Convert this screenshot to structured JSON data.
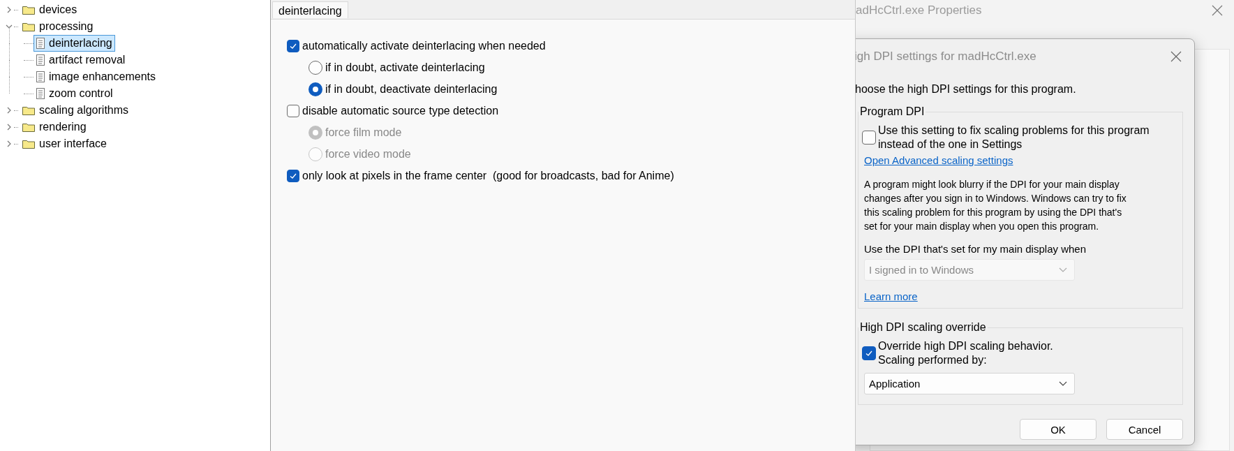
{
  "tree": [
    {
      "label": "devices",
      "kind": "folder",
      "expanded": false,
      "selected": false
    },
    {
      "label": "processing",
      "kind": "folder",
      "expanded": true,
      "selected": false,
      "children": [
        {
          "label": "deinterlacing",
          "kind": "page",
          "selected": true
        },
        {
          "label": "artifact removal",
          "kind": "page",
          "selected": false
        },
        {
          "label": "image enhancements",
          "kind": "page",
          "selected": false
        },
        {
          "label": "zoom control",
          "kind": "page",
          "selected": false
        }
      ]
    },
    {
      "label": "scaling algorithms",
      "kind": "folder",
      "expanded": false,
      "selected": false
    },
    {
      "label": "rendering",
      "kind": "folder",
      "expanded": false,
      "selected": false
    },
    {
      "label": "user interface",
      "kind": "folder",
      "expanded": false,
      "selected": false
    }
  ],
  "panel": {
    "tab": "deinterlacing",
    "options": [
      {
        "label": "automatically activate deinterlacing when needed",
        "checked": true,
        "children": [
          {
            "label": "if in doubt, activate deinterlacing",
            "selected": false,
            "disabled": false
          },
          {
            "label": "if in doubt, deactivate deinterlacing",
            "selected": true,
            "disabled": false
          }
        ]
      },
      {
        "label": "disable automatic source type detection",
        "checked": false,
        "children": [
          {
            "label": "force film mode",
            "selected": true,
            "disabled": true
          },
          {
            "label": "force video mode",
            "selected": false,
            "disabled": true
          }
        ]
      },
      {
        "label": "only look at pixels in the frame center  (good for broadcasts, bad for Anime)",
        "checked": true
      }
    ]
  },
  "properties_window": {
    "title": "adHcCtrl.exe Properties"
  },
  "dialog": {
    "title": "igh DPI settings for madHcCtrl.exe",
    "intro": "hoose the high DPI settings for this program.",
    "program_dpi": {
      "legend": "Program DPI",
      "checkbox": {
        "label": "Use this setting to fix scaling problems for this program\ninstead of the one in Settings",
        "checked": false
      },
      "link": "Open Advanced scaling settings",
      "description": "A program might look blurry if the DPI for your main display\nchanges after you sign in to Windows. Windows can try to fix\nthis scaling problem for this program by using the DPI that's\nset for your main display when you open this program.",
      "dropdown_label": "Use the DPI that's set for my main display when",
      "dropdown": {
        "value": "I signed in to Windows",
        "disabled": true
      },
      "learn_more": "Learn more"
    },
    "override": {
      "legend": "High DPI scaling override",
      "checkbox": {
        "label": "Override high DPI scaling behavior.\nScaling performed by:",
        "checked": true
      },
      "dropdown": {
        "value": "Application",
        "disabled": false
      }
    },
    "buttons": [
      "OK",
      "Cancel"
    ]
  }
}
